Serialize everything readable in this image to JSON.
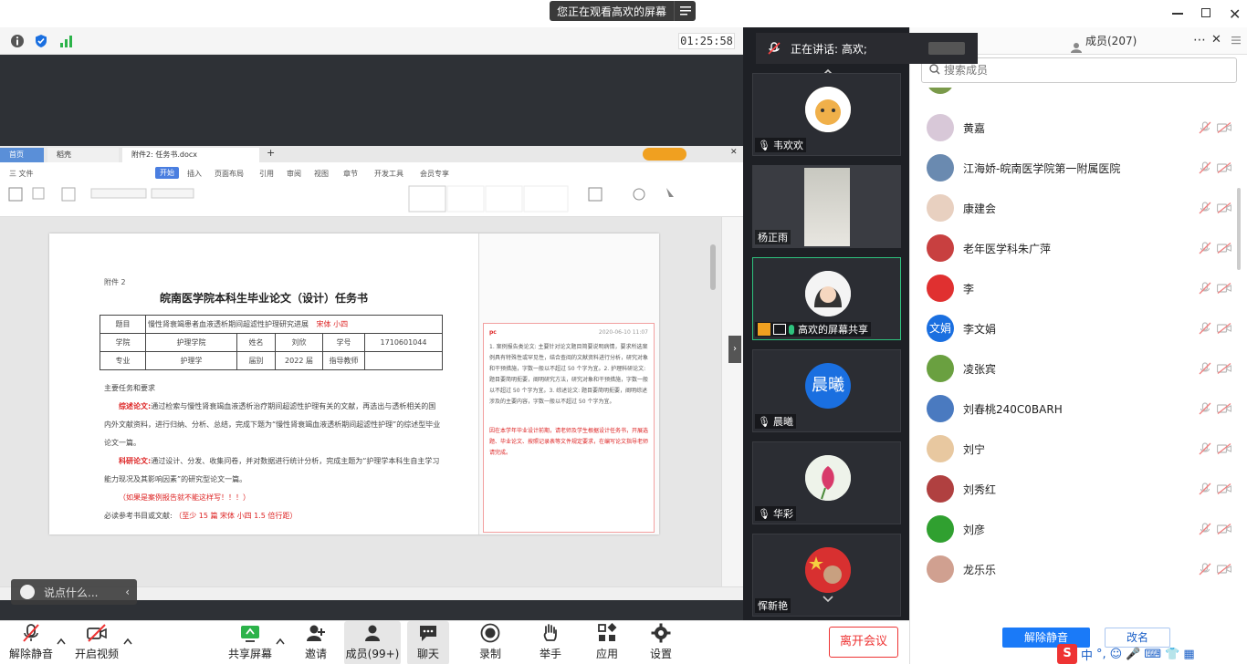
{
  "window": {
    "share_banner": "您正在观看高欢的屏幕",
    "timer": "01:25:58"
  },
  "video": {
    "speaking_label": "正在讲话: 高欢;",
    "tiles": [
      {
        "name": "韦欢欢"
      },
      {
        "name": "杨正雨"
      },
      {
        "name": "高欢的屏幕共享"
      },
      {
        "name": "晨曦",
        "avatar_text": "晨曦"
      },
      {
        "name": "华彩"
      },
      {
        "name": "恽新艳"
      }
    ]
  },
  "members": {
    "tab_label": "成员(207)",
    "search_placeholder": "搜索成员",
    "list": [
      {
        "name": "黄嘉",
        "av_color": "#d8c8d8"
      },
      {
        "name": "江海娇-皖南医学院第一附属医院",
        "av_color": "#6a8ab0"
      },
      {
        "name": "康建会",
        "av_color": "#e8d0c0"
      },
      {
        "name": "老年医学科朱广萍",
        "av_color": "#c84040"
      },
      {
        "name": "李",
        "av_color": "#e03030"
      },
      {
        "name": "李文娟",
        "av_color": "#1a6fe0",
        "av_text": "文娟"
      },
      {
        "name": "凌张宾",
        "av_color": "#6aa040"
      },
      {
        "name": "刘春桃240C0BARH",
        "av_color": "#4a7ac0"
      },
      {
        "name": "刘宁",
        "av_color": "#e8c8a0"
      },
      {
        "name": "刘秀红",
        "av_color": "#b04040"
      },
      {
        "name": "刘彦",
        "av_color": "#30a030"
      },
      {
        "name": "龙乐乐",
        "av_color": "#d0a090"
      }
    ],
    "unmute_all": "解除静音",
    "rename": "改名"
  },
  "toolbar": {
    "unmute": "解除静音",
    "start_video": "开启视频",
    "share_screen": "共享屏幕",
    "invite": "邀请",
    "members": "成员(99+)",
    "chat": "聊天",
    "record": "录制",
    "raise_hand": "举手",
    "apps": "应用",
    "settings": "设置",
    "leave": "离开会议"
  },
  "chat": {
    "placeholder": "说点什么..."
  },
  "document": {
    "tab1": "首页",
    "tab2": "稻壳",
    "tab3": "附件2: 任务书.docx",
    "menu": [
      "三 文件",
      "开始",
      "插入",
      "页面布局",
      "引用",
      "审阅",
      "视图",
      "章节",
      "开发工具",
      "会员专享"
    ],
    "attach": "附件 2",
    "title": "皖南医学院本科生毕业论文（设计）任务书",
    "row1_label": "题目",
    "row1_value": "慢性肾衰竭患者血液透析期间超滤性护理研究进展",
    "row1_note": "宋体  小四",
    "row2": [
      "学院",
      "护理学院",
      "姓名",
      "刘欣",
      "学号",
      "1710601044"
    ],
    "row3": [
      "专业",
      "护理学",
      "届别",
      "2022 届",
      "指导教师",
      ""
    ],
    "task_heading": "主要任务和要求",
    "para1_label": "综述论文:",
    "para1": "通过检索与慢性肾衰竭血液透析治疗期间超滤性护理有关的文献，再选出与透析相关的国内外文献资料，进行归纳、分析、总结，完成下题为“慢性肾衰竭血液透析期间超滤性护理”的综述型毕业论文一篇。",
    "para2_label": "科研论文:",
    "para2": "通过设计、分发、收集问卷，并对数据进行统计分析，完成主题为“护理学本科生自主学习能力现况及其影响因素”的研究型论文一篇。",
    "para3": "（如果是案例报告就不能这样写！！！）",
    "refs": "必读参考书目或文献:",
    "refs_note": "（至少 15 篇    宋体  小四  1.5 倍行距）",
    "comment_author": "pc",
    "comment_date": "2020-06-10 11:07",
    "comment_text": "1. 案例报告类论文: 主要针对论文题目简要说明病情，要求所选案例具有特殊性或罕见性，结合查阅的文献资料进行分析，研究对象和干预措施，字数一般以不超过 50 个字为宜。2. 护理科研论文: 题目要简明扼要，阐明研究方法，研究对象和干预措施，字数一般以不超过 50 个字为宜。3. 综述论文: 题目要简明扼要，阐明综述涉及的主要内容，字数一般以不超过 50 个字为宜。",
    "comment_text2": "因在本学年毕业设计前期，请老师及学生根据设计任务书，开展选题、毕业论文、按照记录表等文件规定要求，在编写论文指导老师请完成。"
  }
}
